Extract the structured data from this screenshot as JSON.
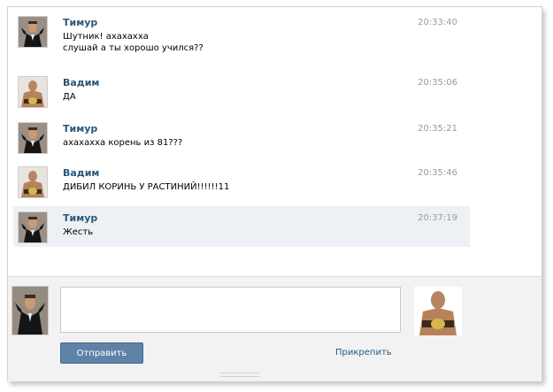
{
  "messages": [
    {
      "author": "Тимур",
      "time": "20:33:40",
      "text": "Шутник! ахахахха\nслушай а ты хорошо учился??"
    },
    {
      "author": "Вадим",
      "time": "20:35:06",
      "text": "ДА"
    },
    {
      "author": "Тимур",
      "time": "20:35:21",
      "text": "ахахахха корень из 81???"
    },
    {
      "author": "Вадим",
      "time": "20:35:46",
      "text": "ДИБИЛ КОРИНЬ У РАСТИНИЙ!!!!!!11"
    },
    {
      "author": "Тимур",
      "time": "20:37:19",
      "text": "Жесть"
    }
  ],
  "composer": {
    "send_label": "Отправить",
    "attach_label": "Прикрепить",
    "message_value": ""
  },
  "colors": {
    "name": "#2b587a",
    "send_button": "#5e82a8",
    "highlight_row": "#edf1f5"
  },
  "icons": {
    "timur_avatar": "avatar-timur-suit",
    "vadim_avatar": "avatar-vadim-wrestler"
  }
}
